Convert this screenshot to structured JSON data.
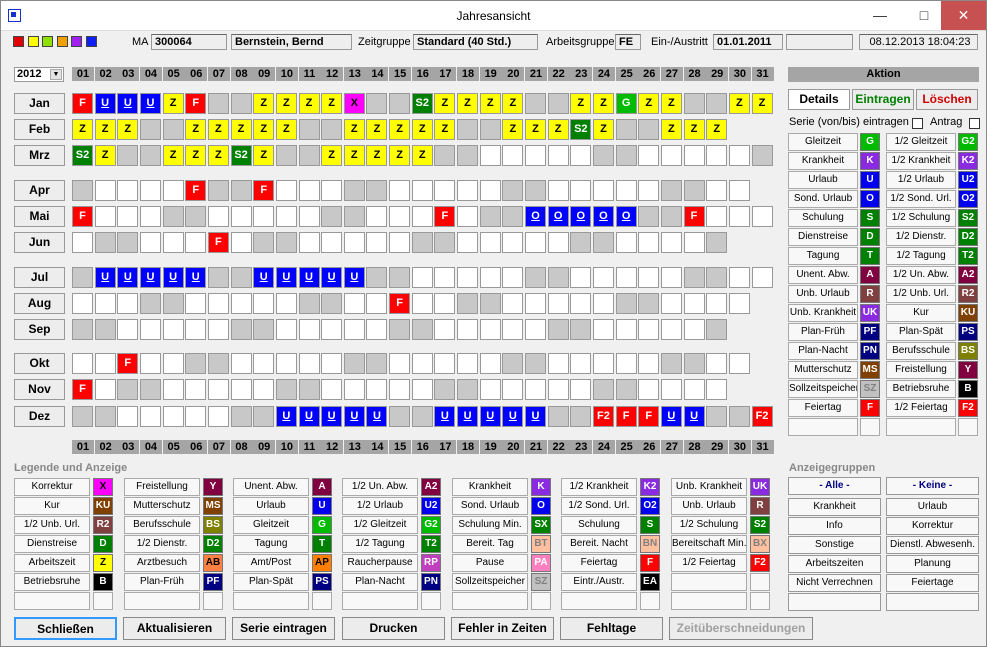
{
  "window": {
    "title": "Jahresansicht"
  },
  "header": {
    "ma_label": "MA",
    "ma_value": "300064",
    "name": "Bernstein, Bernd",
    "zeitgruppe_label": "Zeitgruppe",
    "zeitgruppe_value": "Standard (40 Std.)",
    "arbeitsgruppe_label": "Arbeitsgruppe",
    "arbeitsgruppe_value": "FE",
    "einaus_label": "Ein-/Austritt",
    "einaus_value": "01.01.2011",
    "datetime": "08.12.2013 18:04:23",
    "color_squares": [
      "#e00000",
      "#ffff00",
      "#90e000",
      "#f0a000",
      "#a020f0",
      "#1020f0"
    ]
  },
  "year": "2012",
  "days": [
    "01",
    "02",
    "03",
    "04",
    "05",
    "06",
    "07",
    "08",
    "09",
    "10",
    "11",
    "12",
    "13",
    "14",
    "15",
    "16",
    "17",
    "18",
    "19",
    "20",
    "21",
    "22",
    "23",
    "24",
    "25",
    "26",
    "27",
    "28",
    "29",
    "30",
    "31"
  ],
  "months": [
    {
      "label": "Jan",
      "cells": [
        "F|r",
        "U|b",
        "U|b",
        "U|b",
        "Z|v",
        "F|r",
        "|w",
        "|w",
        "Z|v",
        "Z|v",
        "Z|v",
        "Z|v",
        "X|m",
        "|w",
        "|w",
        "S2|g",
        "Z|v",
        "Z|v",
        "Z|v",
        "Z|v",
        "|w",
        "|w",
        "Z|v",
        "Z|v",
        "G|l",
        "Z|v",
        "Z|v",
        "|w",
        "|w",
        "Z|v",
        "Z|v"
      ]
    },
    {
      "label": "Feb",
      "cells": [
        "Z|v",
        "Z|v",
        "Z|v",
        "|w",
        "|w",
        "Z|v",
        "Z|v",
        "Z|v",
        "Z|v",
        "Z|v",
        "|w",
        "|w",
        "Z|v",
        "Z|v",
        "Z|v",
        "Z|v",
        "Z|v",
        "|w",
        "|w",
        "Z|v",
        "Z|v",
        "Z|v",
        "S2|g",
        "Z|v",
        "|w",
        "|w",
        "Z|v",
        "Z|v",
        "Z|v",
        "X|x",
        "X|x"
      ]
    },
    {
      "label": "Mrz",
      "cells": [
        "S2|g",
        "Z|v",
        "|w",
        "|w",
        "Z|v",
        "Z|v",
        "Z|v",
        "S2|g",
        "Z|v",
        "|w",
        "|w",
        "Z|v",
        "Z|v",
        "Z|v",
        "Z|v",
        "Z|v",
        "|w",
        "|w",
        "|",
        "|",
        "|",
        "|",
        "|",
        "|w",
        "|w",
        "|",
        "|",
        "|",
        "|",
        "|",
        "|w"
      ]
    },
    {
      "label": "Apr",
      "cells": [
        "|w",
        "|",
        "|",
        "|",
        "|",
        "F|r",
        "|w",
        "|w",
        "F|r",
        "|",
        "|",
        "|",
        "|w",
        "|w",
        "|",
        "|",
        "|",
        "|",
        "|",
        "|w",
        "|w",
        "|",
        "|",
        "|",
        "|",
        "|",
        "|w",
        "|w",
        "|",
        "|",
        "X|x"
      ]
    },
    {
      "label": "Mai",
      "cells": [
        "F|r",
        "|",
        "|",
        "|",
        "|w",
        "|w",
        "|",
        "|",
        "|",
        "|",
        "|",
        "|w",
        "|w",
        "|",
        "|",
        "|",
        "F|r",
        "|",
        "|w",
        "|w",
        "O|b",
        "O|b",
        "O|b",
        "O|b",
        "O|b",
        "|w",
        "|w",
        "F|r",
        "|",
        "|",
        "|"
      ]
    },
    {
      "label": "Jun",
      "cells": [
        "|",
        "|w",
        "|w",
        "|",
        "|",
        "|",
        "F|r",
        "|",
        "|w",
        "|w",
        "|",
        "|",
        "|",
        "|",
        "|",
        "|w",
        "|w",
        "|",
        "|",
        "|",
        "|",
        "|",
        "|w",
        "|w",
        "|",
        "|",
        "|",
        "|",
        "|w",
        "X|x"
      ]
    },
    {
      "label": "Jul",
      "cells": [
        "|w",
        "U|b",
        "U|b",
        "U|b",
        "U|b",
        "U|b",
        "|w",
        "|w",
        "U|b",
        "U|b",
        "U|b",
        "U|b",
        "U|b",
        "|w",
        "|w",
        "|",
        "|",
        "|",
        "|",
        "|",
        "|w",
        "|w",
        "|",
        "|",
        "|",
        "|",
        "|",
        "|w",
        "|w",
        "|",
        "|"
      ]
    },
    {
      "label": "Aug",
      "cells": [
        "|",
        "|",
        "|",
        "|w",
        "|w",
        "|",
        "|",
        "|",
        "|",
        "|",
        "|w",
        "|w",
        "|",
        "|",
        "F|r",
        "|",
        "|",
        "|w",
        "|w",
        "|",
        "|",
        "|",
        "|",
        "|",
        "|w",
        "|w",
        "|",
        "|",
        "|",
        "|"
      ]
    },
    {
      "label": "Sep",
      "cells": [
        "|w",
        "|w",
        "|",
        "|",
        "|",
        "|",
        "|",
        "|w",
        "|w",
        "|",
        "|",
        "|",
        "|",
        "|",
        "|w",
        "|w",
        "|",
        "|",
        "|",
        "|",
        "|",
        "|w",
        "|w",
        "|",
        "|",
        "|",
        "|",
        "|",
        "|w",
        "X|x"
      ]
    },
    {
      "label": "Okt",
      "cells": [
        "|",
        "|",
        "F|r",
        "|",
        "|",
        "|w",
        "|w",
        "|",
        "|",
        "|",
        "|",
        "|",
        "|w",
        "|w",
        "|",
        "|",
        "|",
        "|",
        "|",
        "|w",
        "|w",
        "|",
        "|",
        "|",
        "|",
        "|",
        "|w",
        "|w",
        "|",
        "|"
      ]
    },
    {
      "label": "Nov",
      "cells": [
        "F|r",
        "|",
        "|w",
        "|w",
        "|",
        "|",
        "|",
        "|",
        "|",
        "|w",
        "|w",
        "|",
        "|",
        "|",
        "|",
        "|",
        "|w",
        "|w",
        "|",
        "|",
        "|",
        "|",
        "|",
        "|w",
        "|w",
        "|",
        "|",
        "|",
        "|",
        "X|x"
      ]
    },
    {
      "label": "Dez",
      "cells": [
        "|w",
        "|w",
        "|",
        "|",
        "|",
        "|",
        "|",
        "|w",
        "|w",
        "U|b",
        "U|b",
        "U|b",
        "U|b",
        "U|b",
        "|w",
        "|w",
        "U|b",
        "U|b",
        "U|b",
        "U|b",
        "U|b",
        "|w",
        "|w",
        "F2|r",
        "F|r",
        "F|r",
        "U|b",
        "U|b",
        "|w",
        "|w",
        "F2|r"
      ]
    }
  ],
  "aktion": {
    "title": "Aktion",
    "tabs": [
      "Details",
      "Eintragen",
      "Löschen"
    ],
    "serie_label": "Serie (von/bis) eintragen",
    "antrag_label": "Antrag",
    "left": [
      {
        "label": "Gleitzeit",
        "code": "G",
        "bg": "#00bb00",
        "fg": "#ffffff"
      },
      {
        "label": "Krankheit",
        "code": "K",
        "bg": "#8a2be2",
        "fg": "#ffffff"
      },
      {
        "label": "Urlaub",
        "code": "U",
        "bg": "#0000ee",
        "fg": "#ffffff"
      },
      {
        "label": "Sond. Urlaub",
        "code": "O",
        "bg": "#0000ee",
        "fg": "#ffffff"
      },
      {
        "label": "Schulung",
        "code": "S",
        "bg": "#008000",
        "fg": "#ffffff"
      },
      {
        "label": "Dienstreise",
        "code": "D",
        "bg": "#008000",
        "fg": "#ffffff"
      },
      {
        "label": "Tagung",
        "code": "T",
        "bg": "#008000",
        "fg": "#ffffff"
      },
      {
        "label": "Unent. Abw.",
        "code": "A",
        "bg": "#800040",
        "fg": "#ffffff"
      },
      {
        "label": "Unb. Urlaub",
        "code": "R",
        "bg": "#804040",
        "fg": "#ffffff"
      },
      {
        "label": "Unb. Krankheit",
        "code": "UK",
        "bg": "#8a2be2",
        "fg": "#ffffff"
      },
      {
        "label": "Plan-Früh",
        "code": "PF",
        "bg": "#000080",
        "fg": "#ffffff"
      },
      {
        "label": "Plan-Nacht",
        "code": "PN",
        "bg": "#000080",
        "fg": "#ffffff"
      },
      {
        "label": "Mutterschutz",
        "code": "MS",
        "bg": "#804000",
        "fg": "#ffffff"
      },
      {
        "label": "Sollzeitspeicher",
        "code": "SZ",
        "bg": "#c0c0c0",
        "fg": "#808080"
      },
      {
        "label": "Feiertag",
        "code": "F",
        "bg": "#ff0000",
        "fg": "#ffffff"
      }
    ],
    "right": [
      {
        "label": "1/2 Gleitzeit",
        "code": "G2",
        "bg": "#00bb00",
        "fg": "#ffffff"
      },
      {
        "label": "1/2 Krankheit",
        "code": "K2",
        "bg": "#8a2be2",
        "fg": "#ffffff"
      },
      {
        "label": "1/2 Urlaub",
        "code": "U2",
        "bg": "#0000ee",
        "fg": "#ffffff"
      },
      {
        "label": "1/2 Sond. Url.",
        "code": "O2",
        "bg": "#0000ee",
        "fg": "#ffffff"
      },
      {
        "label": "1/2 Schulung",
        "code": "S2",
        "bg": "#008000",
        "fg": "#ffffff"
      },
      {
        "label": "1/2 Dienstr.",
        "code": "D2",
        "bg": "#008000",
        "fg": "#ffffff"
      },
      {
        "label": "1/2 Tagung",
        "code": "T2",
        "bg": "#008000",
        "fg": "#ffffff"
      },
      {
        "label": "1/2 Un. Abw.",
        "code": "A2",
        "bg": "#800040",
        "fg": "#ffffff"
      },
      {
        "label": "1/2 Unb. Url.",
        "code": "R2",
        "bg": "#804040",
        "fg": "#ffffff"
      },
      {
        "label": "Kur",
        "code": "KU",
        "bg": "#804000",
        "fg": "#ffffff"
      },
      {
        "label": "Plan-Spät",
        "code": "PS",
        "bg": "#000080",
        "fg": "#ffffff"
      },
      {
        "label": "Berufsschule",
        "code": "BS",
        "bg": "#808000",
        "fg": "#ffffff"
      },
      {
        "label": "Freistellung",
        "code": "Y",
        "bg": "#800040",
        "fg": "#ffffff"
      },
      {
        "label": "Betriebsruhe",
        "code": "B",
        "bg": "#000000",
        "fg": "#ffffff"
      },
      {
        "label": "1/2 Feiertag",
        "code": "F2",
        "bg": "#ff0000",
        "fg": "#ffffff"
      }
    ]
  },
  "legend": {
    "title": "Legende und Anzeige",
    "columns": [
      [
        {
          "label": "Korrektur",
          "code": "X",
          "bg": "#ff00ff",
          "fg": "#000"
        },
        {
          "label": "Kur",
          "code": "KU",
          "bg": "#804000",
          "fg": "#fff"
        },
        {
          "label": "1/2 Unb. Url.",
          "code": "R2",
          "bg": "#804040",
          "fg": "#fff"
        },
        {
          "label": "Dienstreise",
          "code": "D",
          "bg": "#008000",
          "fg": "#fff"
        },
        {
          "label": "Arbeitszeit",
          "code": "Z",
          "bg": "#ffff00",
          "fg": "#000"
        },
        {
          "label": "Betriebsruhe",
          "code": "B",
          "bg": "#000000",
          "fg": "#fff"
        }
      ],
      [
        {
          "label": "Freistellung",
          "code": "Y",
          "bg": "#800040",
          "fg": "#fff"
        },
        {
          "label": "Mutterschutz",
          "code": "MS",
          "bg": "#804000",
          "fg": "#fff"
        },
        {
          "label": "Berufsschule",
          "code": "BS",
          "bg": "#808000",
          "fg": "#fff"
        },
        {
          "label": "1/2 Dienstr.",
          "code": "D2",
          "bg": "#008000",
          "fg": "#fff"
        },
        {
          "label": "Arztbesuch",
          "code": "AB",
          "bg": "#ff8040",
          "fg": "#000"
        },
        {
          "label": "Plan-Früh",
          "code": "PF",
          "bg": "#000080",
          "fg": "#fff"
        }
      ],
      [
        {
          "label": "Unent. Abw.",
          "code": "A",
          "bg": "#800040",
          "fg": "#fff"
        },
        {
          "label": "Urlaub",
          "code": "U",
          "bg": "#0000ee",
          "fg": "#fff"
        },
        {
          "label": "Gleitzeit",
          "code": "G",
          "bg": "#00bb00",
          "fg": "#fff"
        },
        {
          "label": "Tagung",
          "code": "T",
          "bg": "#008000",
          "fg": "#fff"
        },
        {
          "label": "Amt/Post",
          "code": "AP",
          "bg": "#ff8000",
          "fg": "#000"
        },
        {
          "label": "Plan-Spät",
          "code": "PS",
          "bg": "#000080",
          "fg": "#fff"
        }
      ],
      [
        {
          "label": "1/2 Un. Abw.",
          "code": "A2",
          "bg": "#800040",
          "fg": "#fff"
        },
        {
          "label": "1/2 Urlaub",
          "code": "U2",
          "bg": "#0000ee",
          "fg": "#fff"
        },
        {
          "label": "1/2 Gleitzeit",
          "code": "G2",
          "bg": "#00bb00",
          "fg": "#fff"
        },
        {
          "label": "1/2 Tagung",
          "code": "T2",
          "bg": "#008000",
          "fg": "#fff"
        },
        {
          "label": "Raucherpause",
          "code": "RP",
          "bg": "#c040c0",
          "fg": "#fff"
        },
        {
          "label": "Plan-Nacht",
          "code": "PN",
          "bg": "#000080",
          "fg": "#fff"
        }
      ],
      [
        {
          "label": "Krankheit",
          "code": "K",
          "bg": "#8a2be2",
          "fg": "#fff"
        },
        {
          "label": "Sond. Urlaub",
          "code": "O",
          "bg": "#0000ee",
          "fg": "#fff"
        },
        {
          "label": "Schulung Min.",
          "code": "SX",
          "bg": "#008000",
          "fg": "#fff"
        },
        {
          "label": "Bereit. Tag",
          "code": "BT",
          "bg": "#ffc0a0",
          "fg": "#808080"
        },
        {
          "label": "Pause",
          "code": "PA",
          "bg": "#ff80c0",
          "fg": "#fff"
        },
        {
          "label": "Sollzeitspeicher",
          "code": "SZ",
          "bg": "#c0c0c0",
          "fg": "#808080"
        }
      ],
      [
        {
          "label": "1/2 Krankheit",
          "code": "K2",
          "bg": "#8a2be2",
          "fg": "#fff"
        },
        {
          "label": "1/2 Sond. Url.",
          "code": "O2",
          "bg": "#0000ee",
          "fg": "#fff"
        },
        {
          "label": "Schulung",
          "code": "S",
          "bg": "#008000",
          "fg": "#fff"
        },
        {
          "label": "Bereit. Nacht",
          "code": "BN",
          "bg": "#ffc0a0",
          "fg": "#808080"
        },
        {
          "label": "Feiertag",
          "code": "F",
          "bg": "#ff0000",
          "fg": "#fff"
        },
        {
          "label": "Eintr./Austr.",
          "code": "EA",
          "bg": "#000000",
          "fg": "#fff"
        }
      ],
      [
        {
          "label": "Unb. Krankheit",
          "code": "UK",
          "bg": "#8a2be2",
          "fg": "#fff"
        },
        {
          "label": "Unb. Urlaub",
          "code": "R",
          "bg": "#804040",
          "fg": "#fff"
        },
        {
          "label": "1/2 Schulung",
          "code": "S2",
          "bg": "#008000",
          "fg": "#fff"
        },
        {
          "label": "Bereitschaft Min.",
          "code": "BX",
          "bg": "#ffc0a0",
          "fg": "#808080"
        },
        {
          "label": "1/2 Feiertag",
          "code": "F2",
          "bg": "#ff0000",
          "fg": "#fff"
        }
      ]
    ]
  },
  "gruppen": {
    "title": "Anzeigegruppen",
    "alle": "- Alle -",
    "keine": "- Keine -",
    "left": [
      "Krankheit",
      "Info",
      "Sonstige",
      "Arbeitszeiten",
      "Nicht Verrechnen"
    ],
    "right": [
      "Urlaub",
      "Korrektur",
      "Dienstl. Abwesenh.",
      "Planung",
      "Feiertage"
    ]
  },
  "buttons": [
    "Schließen",
    "Aktualisieren",
    "Serie eintragen",
    "Drucken",
    "Fehler in Zeiten",
    "Fehltage",
    "Zeitüberschneidungen"
  ]
}
